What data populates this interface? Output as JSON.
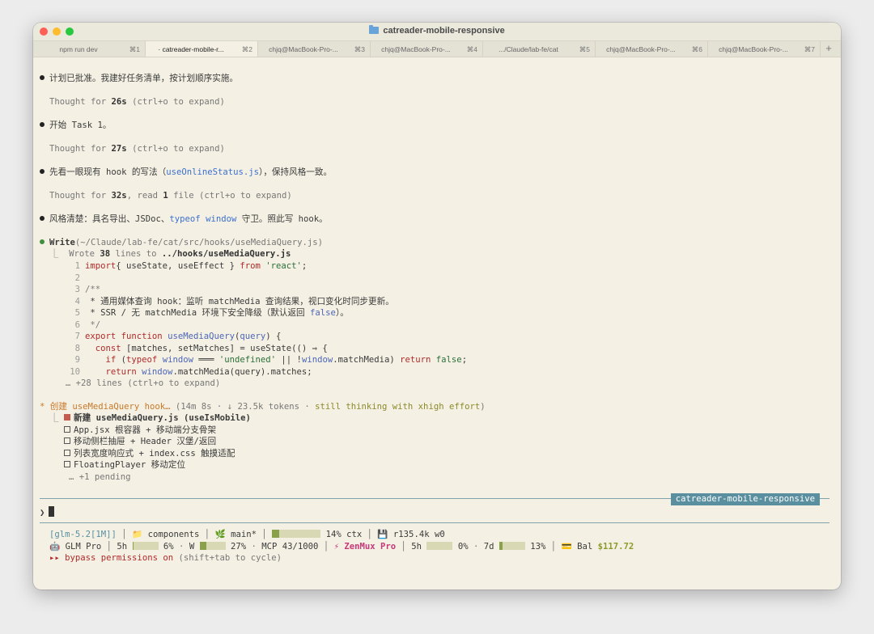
{
  "window": {
    "title": "catreader-mobile-responsive"
  },
  "tabs": [
    {
      "label": "npm run dev",
      "shortcut": "⌘1"
    },
    {
      "label": "· catreader-mobile-r...",
      "shortcut": "⌘2"
    },
    {
      "label": "chjq@MacBook-Pro-...",
      "shortcut": "⌘3"
    },
    {
      "label": "chjq@MacBook-Pro-...",
      "shortcut": "⌘4"
    },
    {
      "label": ".../Claude/lab-fe/cat",
      "shortcut": "⌘5"
    },
    {
      "label": "chjq@MacBook-Pro-...",
      "shortcut": "⌘6"
    },
    {
      "label": "chjq@MacBook-Pro-...",
      "shortcut": "⌘7"
    }
  ],
  "new_tab": "+",
  "transcript": {
    "m1": "计划已批准。我建好任务清单，按计划顺序实施。",
    "t1a": "Thought for ",
    "t1b": "26s",
    "t1c": " (ctrl+o to expand)",
    "m2": "开始 Task 1。",
    "t2a": "Thought for ",
    "t2b": "27s",
    "t2c": " (ctrl+o to expand)",
    "m3a": "先看一眼现有 hook 的写法（",
    "m3b": "useOnlineStatus.js",
    "m3c": "），保持风格一致。",
    "t3a": "Thought for ",
    "t3b": "32s",
    "t3c": ", read ",
    "t3d": "1",
    "t3e": " file (ctrl+o to expand)",
    "m4a": "风格清楚：具名导出、JSDoc、",
    "m4b": "typeof window",
    "m4c": " 守卫。照此写 hook。",
    "w1": "Write",
    "w2": "(~/Claude/lab-fe/cat/src/hooks/useMediaQuery.js)",
    "w3a": "  ⎿  Wrote ",
    "w3b": "38",
    "w3c": " lines to ",
    "w3d": "../hooks/useMediaQuery.js",
    "more": "     … +28 lines (ctrl+o to expand)"
  },
  "code": [
    {
      "n": "1",
      "parts": [
        [
          "kw",
          "import"
        ],
        [
          "",
          "{ useState, useEffect } "
        ],
        [
          "kw",
          "from"
        ],
        [
          "str",
          " 'react'"
        ],
        [
          "",
          ";"
        ]
      ]
    },
    {
      "n": "2",
      "parts": []
    },
    {
      "n": "3",
      "parts": [
        [
          "cm",
          "/**"
        ]
      ]
    },
    {
      "n": "4",
      "parts": [
        [
          "",
          " * 通用媒体查询 hook：监听 matchMedia 查询结果，视口变化时同步更新。"
        ]
      ]
    },
    {
      "n": "5",
      "parts": [
        [
          "",
          " * SSR / 无 matchMedia 环境下安全降级（默认返回 "
        ],
        [
          "fn",
          "false"
        ],
        [
          "",
          "）。"
        ]
      ]
    },
    {
      "n": "6",
      "parts": [
        [
          "cm",
          " */"
        ]
      ]
    },
    {
      "n": "7",
      "parts": [
        [
          "kw",
          "export function "
        ],
        [
          "fn",
          "useMediaQuery"
        ],
        [
          "",
          "("
        ],
        [
          "fn",
          "query"
        ],
        [
          "",
          ") {"
        ]
      ]
    },
    {
      "n": "8",
      "parts": [
        [
          "kw",
          "  const "
        ],
        [
          "",
          "[matches, setMatches] = useState(() ⇒ {"
        ]
      ]
    },
    {
      "n": "9",
      "parts": [
        [
          "kw",
          "    if "
        ],
        [
          "",
          "("
        ],
        [
          "kw",
          "typeof "
        ],
        [
          "fn",
          "window"
        ],
        [
          "",
          " ═══ "
        ],
        [
          "str",
          "'undefined'"
        ],
        [
          "",
          " || !"
        ],
        [
          "fn",
          "window"
        ],
        [
          "",
          ".matchMedia) "
        ],
        [
          "kw",
          "return "
        ],
        [
          "str",
          "false"
        ],
        [
          "",
          ";"
        ]
      ]
    },
    {
      "n": "10",
      "parts": [
        [
          "kw",
          "    return "
        ],
        [
          "fn",
          "window"
        ],
        [
          "",
          ".matchMedia(query).matches;"
        ]
      ]
    }
  ],
  "task": {
    "star": "*",
    "title": " 创建 ",
    "name": "useMediaQuery hook…",
    "stats": " (14m 8s · ↓ 23.5k tokens · ",
    "thinking": "still thinking with xhigh effort",
    "close": ")",
    "items": [
      {
        "label": "新建 ",
        "code": "useMediaQuery.js (useIsMobile)",
        "done": true
      },
      {
        "label": "App.jsx 根容器 + 移动端分支骨架",
        "code": "",
        "done": false
      },
      {
        "label": "移动侧栏抽屉 + Header 汉堡/返回",
        "code": "",
        "done": false
      },
      {
        "label": "列表宽度响应式 + index.css 触摸适配",
        "code": "",
        "done": false
      },
      {
        "label": "FloatingPlayer 移动定位",
        "code": "",
        "done": false
      }
    ],
    "pending": "… +1 pending"
  },
  "prompt": {
    "branch_tag": "catreader-mobile-responsive",
    "symbol": "❯"
  },
  "status": {
    "model": "[glm-5.2[1M]]",
    "dir": "📁 components",
    "git": "🌿 main*",
    "ctx_pct": "14% ctx",
    "ctx_fraction": 0.14,
    "mem": "💾 r135.4k w0",
    "provider": "🤖 GLM Pro",
    "h5": "5h",
    "h5_pct": "6%",
    "h5_fraction": 0.06,
    "w_label": "W",
    "w_pct": "27%",
    "w_fraction": 0.27,
    "mcp": "MCP 43/1000",
    "zen": "⚡ ZenMux Pro",
    "zh5": "5h",
    "zh5_pct": "0%",
    "zh5_fraction": 0.0,
    "d7": "7d",
    "d7_pct": "13%",
    "d7_fraction": 0.13,
    "bal_label": "💳 Bal ",
    "bal": "$117.72",
    "bypass_arrow": "▸▸",
    "bypass": " bypass permissions on",
    "bypass_hint": " (shift+tab to cycle)"
  },
  "colors": {
    "background": "#f4f1e4",
    "accent": "#5a8fa0",
    "bar_fill": "#8aa04a",
    "bar_track": "#d9d8b4"
  }
}
